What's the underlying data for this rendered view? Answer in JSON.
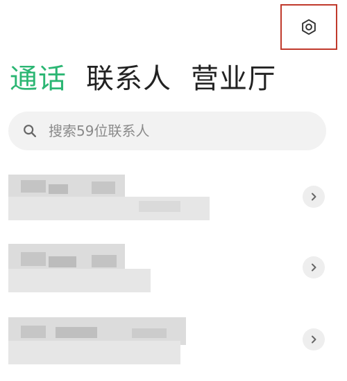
{
  "header": {
    "settings_icon": "settings-hexagon-icon",
    "highlight_color": "#c0392b"
  },
  "tabs": [
    {
      "label": "通话",
      "active": true
    },
    {
      "label": "联系人",
      "active": false
    },
    {
      "label": "营业厅",
      "active": false
    }
  ],
  "accent_color": "#2bb673",
  "search": {
    "icon": "search-icon",
    "placeholder": "搜索59位联系人"
  },
  "contacts": [
    {
      "name": "",
      "detail": "",
      "pixelated": true,
      "chevron_icon": "chevron-right-icon"
    },
    {
      "name": "",
      "detail": "",
      "pixelated": true,
      "chevron_icon": "chevron-right-icon"
    },
    {
      "name": "",
      "detail": "",
      "pixelated": true,
      "chevron_icon": "chevron-right-icon"
    }
  ]
}
